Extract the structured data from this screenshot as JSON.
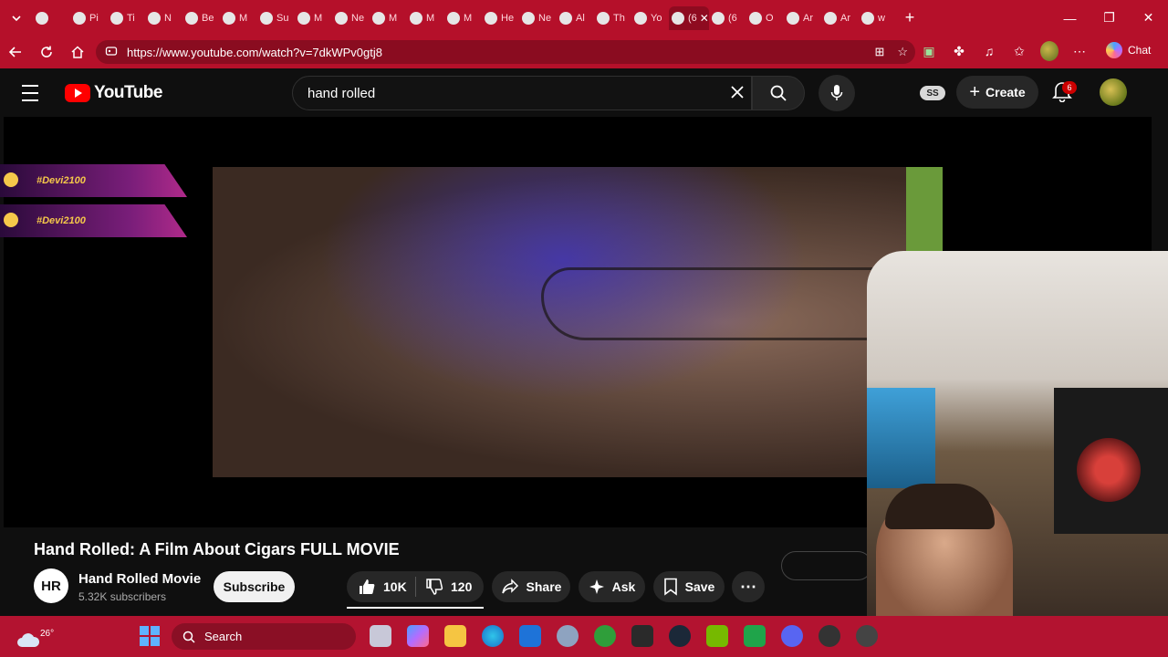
{
  "browser": {
    "tabs": [
      {
        "label": "",
        "icon": "app-icon"
      },
      {
        "label": "Pi"
      },
      {
        "label": "Ti"
      },
      {
        "label": "N"
      },
      {
        "label": "Be"
      },
      {
        "label": "M"
      },
      {
        "label": "Su"
      },
      {
        "label": "M"
      },
      {
        "label": "Ne"
      },
      {
        "label": "M"
      },
      {
        "label": "M"
      },
      {
        "label": "M"
      },
      {
        "label": "He"
      },
      {
        "label": "Ne"
      },
      {
        "label": "Al"
      },
      {
        "label": "Th"
      },
      {
        "label": "Yo"
      },
      {
        "label": "(6"
      },
      {
        "label": "(6"
      },
      {
        "label": "O"
      },
      {
        "label": "Ar"
      },
      {
        "label": "Ar"
      },
      {
        "label": "w"
      }
    ],
    "active_tab_label": "(6",
    "url": "https://www.youtube.com/watch?v=7dkWPv0gtj8",
    "chat_label": "Chat",
    "theme_color": "#b5102a"
  },
  "youtube": {
    "logo_text": "YouTube",
    "search_value": "hand rolled",
    "ss_badge": "SS",
    "create_label": "Create",
    "notification_count": "6"
  },
  "overlay": {
    "tags": [
      "#Devi2100",
      "#Devi2100"
    ]
  },
  "video": {
    "title": "Hand Rolled: A Film About Cigars FULL MOVIE",
    "channel_name": "Hand Rolled Movie",
    "channel_initials": "HR",
    "subscribers": "5.32K subscribers",
    "subscribe_label": "Subscribe",
    "likes": "10K",
    "dislikes": "120",
    "share_label": "Share",
    "ask_label": "Ask",
    "save_label": "Save"
  },
  "taskbar": {
    "temperature": "26°",
    "search_label": "Search",
    "accent": "#b31330"
  }
}
